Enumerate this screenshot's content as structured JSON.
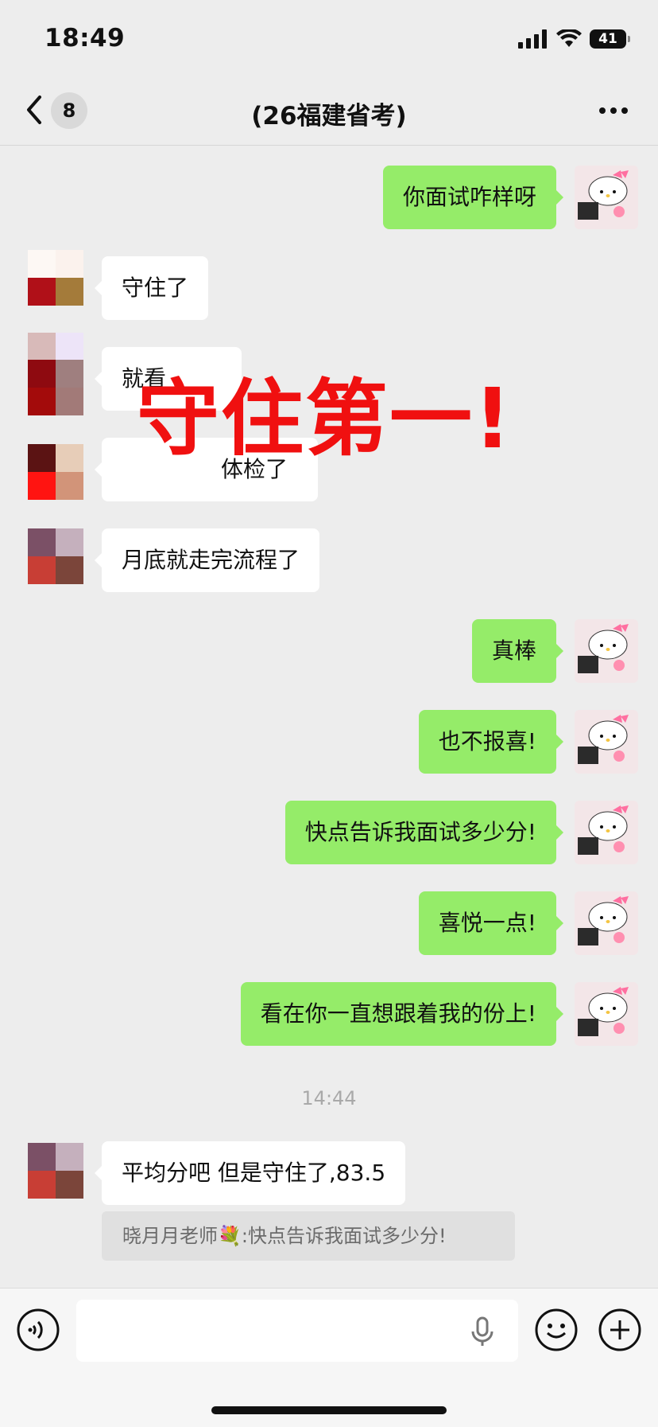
{
  "status_bar": {
    "time": "18:49",
    "battery": "41"
  },
  "nav": {
    "back_count": "8",
    "title": "(26福建省考)"
  },
  "messages": [
    {
      "text": "你面试咋样呀"
    },
    {
      "text": "守住了"
    },
    {
      "text": "就看"
    },
    {
      "text": "体检了"
    },
    {
      "text": "月底就走完流程了"
    },
    {
      "text": "真棒"
    },
    {
      "text": "也不报喜!"
    },
    {
      "text": "快点告诉我面试多少分!"
    },
    {
      "text": "喜悦一点!"
    },
    {
      "text": "看在你一直想跟着我的份上!"
    },
    {
      "text": "平均分吧 但是守住了,83.5"
    }
  ],
  "timestamp": "14:44",
  "quote": {
    "sender": "晓月月老师💐:",
    "text": "快点告诉我面试多少分!"
  },
  "overlay_text": "守住第一!",
  "colors": {
    "outgoing_bubble": "#95ec69",
    "incoming_bubble": "#ffffff",
    "background": "#ededed",
    "overlay": "#f01010"
  }
}
